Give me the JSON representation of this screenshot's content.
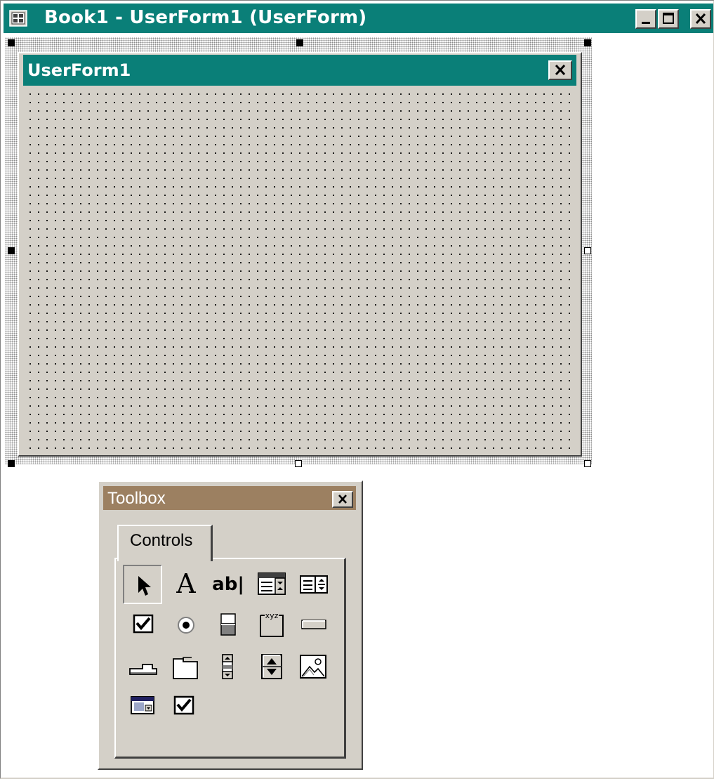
{
  "window": {
    "title": "Book1 - UserForm1 (UserForm)",
    "icon": "userform-window-icon",
    "caption_buttons": [
      "minimize-icon",
      "maximize-icon",
      "close-icon"
    ],
    "title_color": "#0a7f78"
  },
  "userform": {
    "title": "UserForm1",
    "close_icon": "close-icon",
    "background_color": "#d4d0c8",
    "grid": "dotted"
  },
  "toolbox": {
    "title": "Toolbox",
    "title_color": "#9c8061",
    "close_icon": "close-icon",
    "tabs": [
      {
        "label": "Controls",
        "selected": true
      }
    ],
    "tools": [
      {
        "name": "select-objects-icon",
        "pressed": true
      },
      {
        "name": "label-icon",
        "glyph": "A"
      },
      {
        "name": "textbox-icon",
        "glyph": "ab|"
      },
      {
        "name": "combobox-icon"
      },
      {
        "name": "listbox-icon"
      },
      {
        "name": "checkbox-icon"
      },
      {
        "name": "optionbutton-icon"
      },
      {
        "name": "togglebutton-icon"
      },
      {
        "name": "frame-icon",
        "glyph": "xyz"
      },
      {
        "name": "commandbutton-icon"
      },
      {
        "name": "tabstrip-icon"
      },
      {
        "name": "multipage-icon"
      },
      {
        "name": "scrollbar-icon"
      },
      {
        "name": "spinbutton-icon"
      },
      {
        "name": "image-icon"
      },
      {
        "name": "refedit-icon"
      },
      {
        "name": "checkbox-icon"
      }
    ]
  }
}
